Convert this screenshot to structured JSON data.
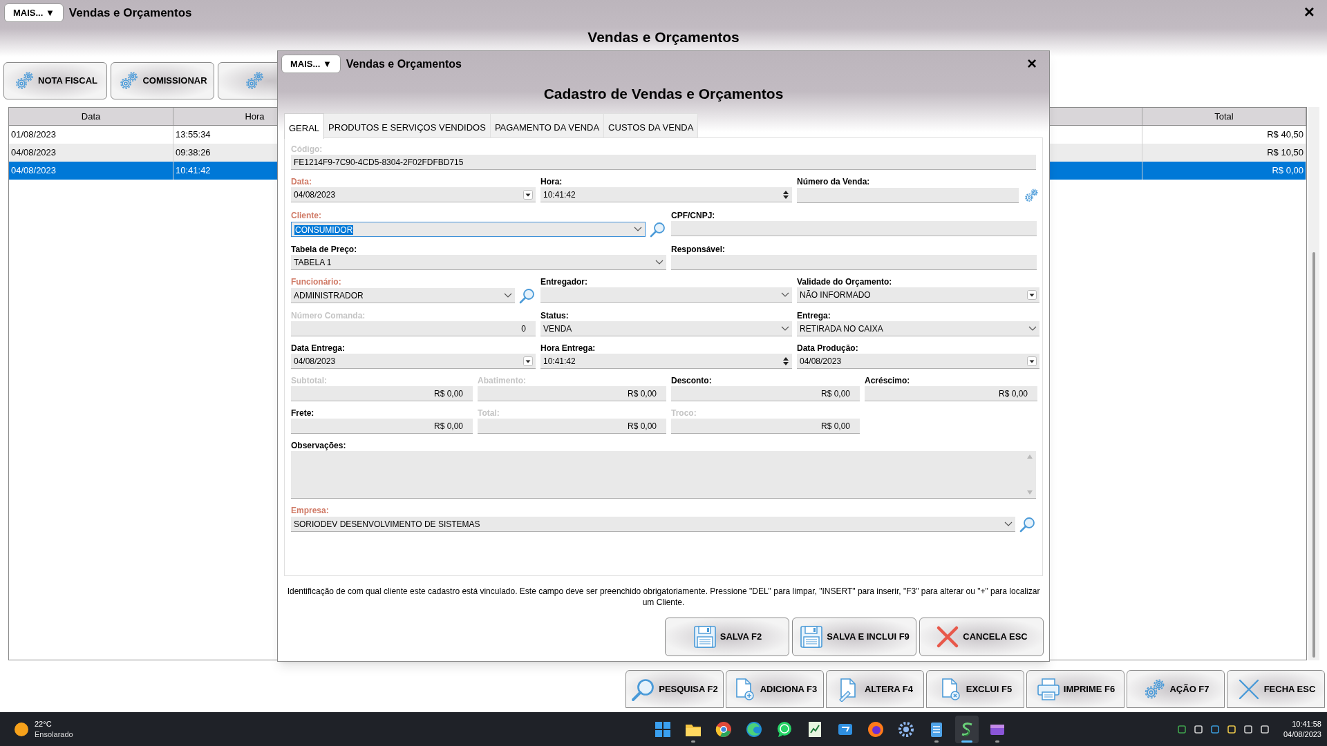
{
  "window": {
    "menu_button": "MAIS... ▼",
    "title": "Vendas e Orçamentos",
    "close": "×",
    "heading": "Vendas e Orçamentos"
  },
  "actions": [
    {
      "kind": "labeled",
      "label": "NOTA FISCAL"
    },
    {
      "kind": "labeled",
      "label": "COMISSIONAR"
    },
    {
      "kind": "partial"
    }
  ],
  "table": {
    "columns": [
      {
        "label": "Data"
      },
      {
        "label": "Hora"
      },
      {
        "label": "Total"
      }
    ],
    "rows": [
      {
        "cells": [
          "01/08/2023",
          "13:55:34",
          "R$ 40,50"
        ],
        "selected": false
      },
      {
        "cells": [
          "04/08/2023",
          "09:38:26",
          "R$ 10,50"
        ],
        "selected": false
      },
      {
        "cells": [
          "04/08/2023",
          "10:41:42",
          "R$ 0,00"
        ],
        "selected": true
      }
    ]
  },
  "bottom_buttons": [
    {
      "label": "PESQUISA F2"
    },
    {
      "label": "ADICIONA F3"
    },
    {
      "label": "ALTERA F4"
    },
    {
      "label": "EXCLUI F5"
    },
    {
      "label": "IMPRIME F6"
    },
    {
      "label": "AÇÃO F7"
    },
    {
      "label": "FECHA ESC"
    }
  ],
  "dialog": {
    "menu_button": "MAIS... ▼",
    "title": "Vendas e Orçamentos",
    "close": "×",
    "heading": "Cadastro de Vendas e Orçamentos",
    "tabs": [
      {
        "label": "GERAL",
        "selected": true
      },
      {
        "label": "PRODUTOS E SERVIÇOS VENDIDOS",
        "selected": false
      },
      {
        "label": "PAGAMENTO DA VENDA",
        "selected": false
      },
      {
        "label": "CUSTOS DA VENDA",
        "selected": false
      }
    ],
    "form": [
      [
        {
          "label": "Código:",
          "required": false,
          "disabled": true,
          "kind": "text",
          "value": "FE1214F9-7C90-4CD5-8304-2F02FDFBD715"
        }
      ],
      [
        {
          "label": "Data:",
          "required": true,
          "disabled": false,
          "kind": "date",
          "value": "04/08/2023"
        },
        {
          "label": "Hora:",
          "required": false,
          "disabled": false,
          "kind": "time",
          "value": "10:41:42"
        },
        {
          "label": "Número da Venda:",
          "required": false,
          "disabled": false,
          "kind": "text",
          "gear_button": true
        }
      ],
      [
        {
          "label": "Cliente:",
          "required": true,
          "disabled": false,
          "kind": "combo",
          "value": "CONSUMIDOR",
          "focused": true,
          "value_selected": true,
          "search_button": true
        },
        {
          "label": "CPF/CNPJ:",
          "required": false,
          "disabled": false,
          "kind": "text"
        }
      ],
      [
        {
          "label": "Tabela de Preço:",
          "required": false,
          "disabled": false,
          "kind": "combo",
          "value": "TABELA 1"
        },
        {
          "label": "Responsável:",
          "required": false,
          "disabled": false,
          "kind": "text"
        }
      ],
      [
        {
          "label": "Funcionário:",
          "required": true,
          "disabled": false,
          "kind": "combo",
          "value": "ADMINISTRADOR",
          "search_button": true
        },
        {
          "label": "Entregador:",
          "required": false,
          "disabled": false,
          "kind": "combo"
        },
        {
          "label": "Validade do Orçamento:",
          "required": false,
          "disabled": false,
          "kind": "date",
          "value": "NÃO INFORMADO"
        }
      ],
      [
        {
          "label": "Número Comanda:",
          "required": false,
          "disabled": true,
          "kind": "number",
          "value": "0"
        },
        {
          "label": "Status:",
          "required": false,
          "disabled": false,
          "kind": "combo",
          "value": "VENDA"
        },
        {
          "label": "Entrega:",
          "required": false,
          "disabled": false,
          "kind": "combo",
          "value": "RETIRADA NO CAIXA"
        }
      ],
      [
        {
          "label": "Data Entrega:",
          "required": false,
          "disabled": false,
          "kind": "date",
          "value": "04/08/2023"
        },
        {
          "label": "Hora Entrega:",
          "required": false,
          "disabled": false,
          "kind": "time",
          "value": "10:41:42"
        },
        {
          "label": "Data Produção:",
          "required": false,
          "disabled": false,
          "kind": "date",
          "value": "04/08/2023"
        }
      ],
      [
        {
          "label": "Subtotal:",
          "required": false,
          "disabled": true,
          "kind": "number",
          "value": "R$ 0,00"
        },
        {
          "label": "Abatimento:",
          "required": false,
          "disabled": true,
          "kind": "number",
          "value": "R$ 0,00"
        },
        {
          "label": "Desconto:",
          "required": false,
          "disabled": false,
          "kind": "number",
          "value": "R$ 0,00"
        },
        {
          "label": "Acréscimo:",
          "required": false,
          "disabled": false,
          "kind": "number",
          "value": "R$ 0,00"
        }
      ],
      [
        {
          "label": "Frete:",
          "required": false,
          "disabled": false,
          "kind": "number",
          "value": "R$ 0,00"
        },
        {
          "label": "Total:",
          "required": false,
          "disabled": true,
          "kind": "number",
          "value": "R$ 0,00"
        },
        {
          "label": "Troco:",
          "required": false,
          "disabled": true,
          "kind": "number",
          "value": "R$ 0,00"
        }
      ],
      [
        {
          "label": "Observações:",
          "required": false,
          "disabled": false,
          "kind": "memo"
        }
      ],
      [
        {
          "label": "Empresa:",
          "required": true,
          "disabled": false,
          "kind": "combo",
          "value": "SORIODEV DESENVOLVIMENTO DE SISTEMAS",
          "search_button": true
        }
      ]
    ],
    "help": "Identificação de com qual cliente este cadastro está vinculado. Este campo deve ser preenchido obrigatoriamente. Pressione \"DEL\" para limpar, \"INSERT\" para inserir, \"F3\" para alterar ou \"+\" para localizar um Cliente.",
    "buttons": [
      {
        "label": "SALVA F2"
      },
      {
        "label": "SALVA E INCLUI F9"
      },
      {
        "label": "CANCELA ESC"
      }
    ]
  },
  "taskbar": {
    "weather": {
      "temp": "22°C",
      "condition": "Ensolarado"
    },
    "apps": [
      {
        "kind": "start",
        "running": false,
        "active": false
      },
      {
        "kind": "folder",
        "running": true,
        "active": false
      },
      {
        "kind": "browser-round",
        "running": false,
        "active": false
      },
      {
        "kind": "browser-wave",
        "running": false,
        "active": false
      },
      {
        "kind": "chat",
        "running": false,
        "active": false
      },
      {
        "kind": "sheet",
        "running": false,
        "active": false
      },
      {
        "kind": "mail",
        "running": false,
        "active": false
      },
      {
        "kind": "browser-fire",
        "running": false,
        "active": false
      },
      {
        "kind": "settings",
        "running": false,
        "active": false
      },
      {
        "kind": "notepad",
        "running": true,
        "active": false
      },
      {
        "kind": "app",
        "running": true,
        "active": true
      },
      {
        "kind": "video",
        "running": true,
        "active": false
      }
    ],
    "time": "10:41:58",
    "date": "04/08/2023"
  }
}
